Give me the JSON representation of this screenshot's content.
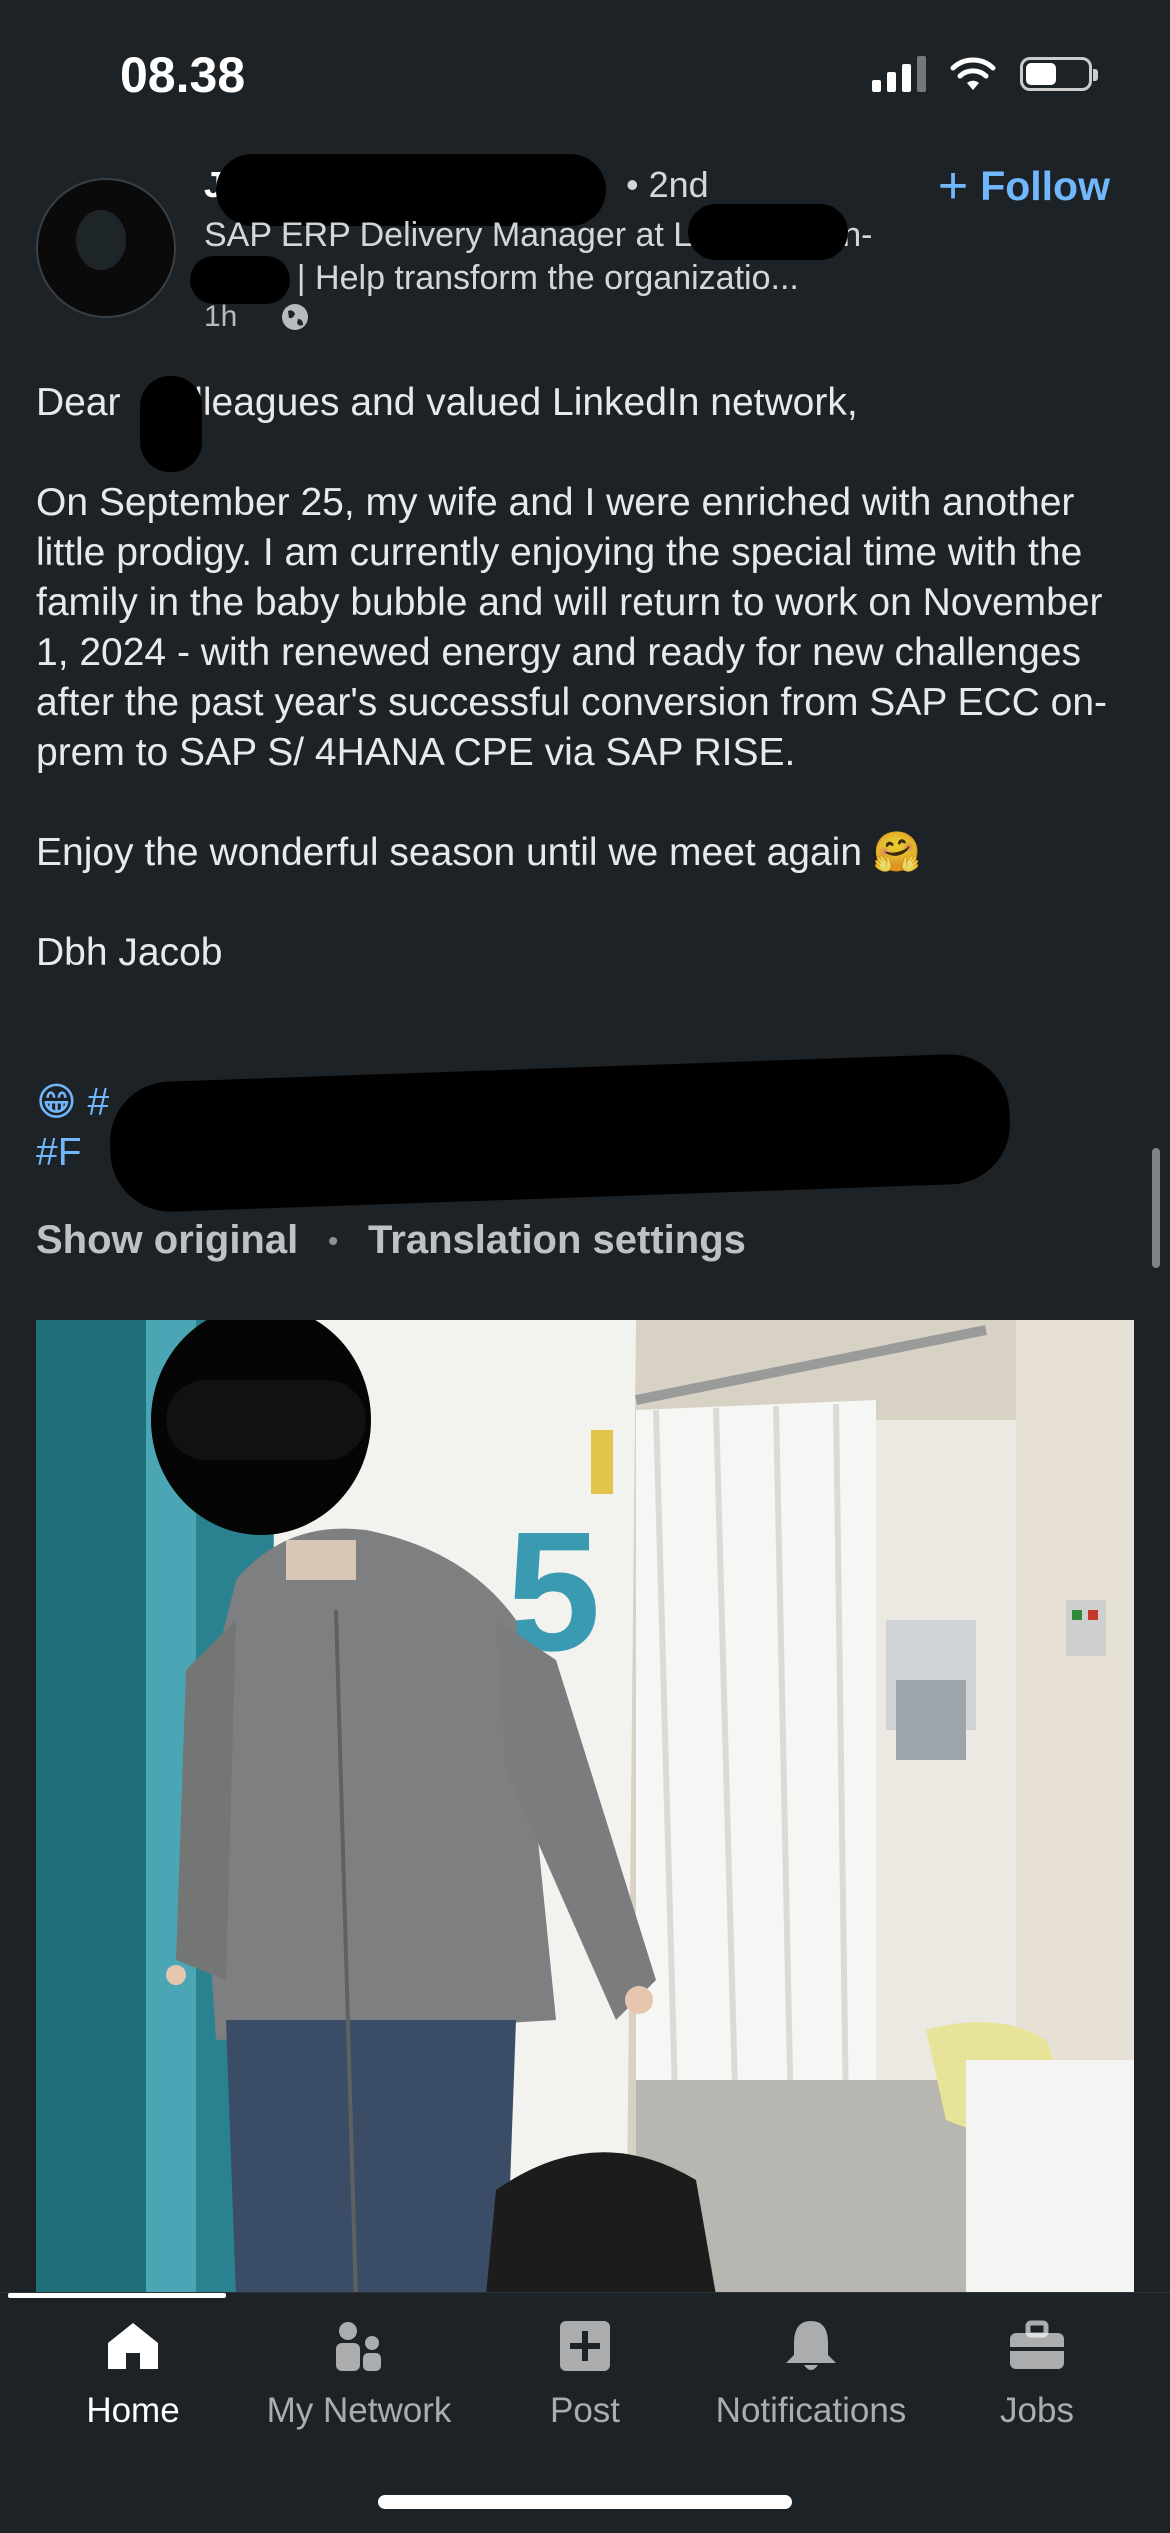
{
  "status_bar": {
    "time": "08.38"
  },
  "post": {
    "author_initial": "J",
    "degree": "• 2nd",
    "headline_line1": "SAP ERP Delivery Manager at L",
    "headline_line1_end": "n-",
    "headline_line2_end": "r | Help transform the organizatio...",
    "time_ago": "1h",
    "follow_label": "Follow",
    "body_paragraphs": [
      "Dear   colleagues and valued LinkedIn network,",
      "On September 25, my wife and I were enriched with another little prodigy. I am currently enjoying the special time with the family in the baby bubble and will return to work on November 1, 2024 - with renewed energy and ready for new challenges after the past year's successful conversion from SAP ECC on-prem to SAP S/ 4HANA CPE via SAP RISE.",
      "Enjoy the wonderful season until we meet again 🤗",
      "Dbh Jacob"
    ],
    "hashtags_line1": "😁 #",
    "hashtags_line2": "#F",
    "show_original": "Show original",
    "translation_settings": "Translation settings"
  },
  "tabs": [
    {
      "label": "Home",
      "icon": "home-icon",
      "active": true
    },
    {
      "label": "My Network",
      "icon": "network-icon",
      "active": false
    },
    {
      "label": "Post",
      "icon": "post-icon",
      "active": false
    },
    {
      "label": "Notifications",
      "icon": "bell-icon",
      "active": false
    },
    {
      "label": "Jobs",
      "icon": "briefcase-icon",
      "active": false
    }
  ],
  "colors": {
    "background": "#1d2226",
    "link": "#71b7fb",
    "text": "#ffffffe6"
  }
}
